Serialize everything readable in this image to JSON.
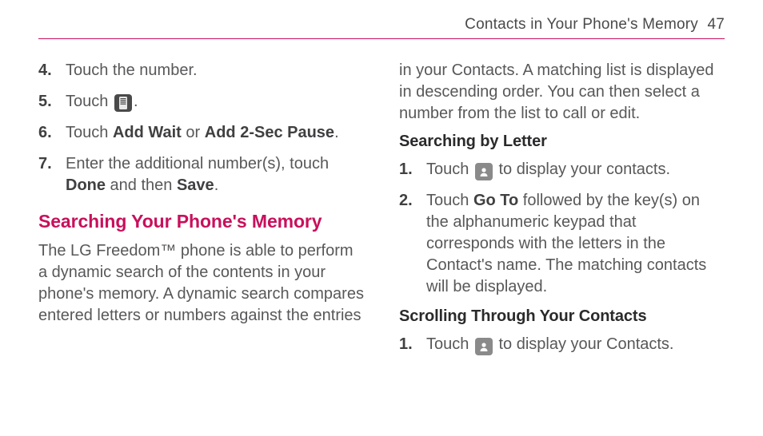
{
  "header": {
    "section": "Contacts in Your Phone's Memory",
    "page_number": "47"
  },
  "left": {
    "steps": [
      {
        "n": "4.",
        "text": "Touch the number."
      },
      {
        "n": "5.",
        "pre": "Touch ",
        "icon": "keypad-icon",
        "post": "."
      },
      {
        "n": "6.",
        "pre": "Touch ",
        "b1": "Add Wait",
        "mid": " or ",
        "b2": "Add 2-Sec Pause",
        "post": "."
      },
      {
        "n": "7.",
        "pre": "Enter the additional number(s), touch ",
        "b1": "Done",
        "mid": " and then ",
        "b2": "Save",
        "post": "."
      }
    ],
    "heading": "Searching Your Phone's Memory",
    "para": "The LG Freedom™ phone is able to perform a dynamic search of the contents in your phone's memory. A dynamic search compares entered letters or numbers against the entries"
  },
  "right": {
    "cont": "in your Contacts. A matching list is displayed in descending order. You can then select a number from the list to call or edit.",
    "sub1": "Searching by Letter",
    "steps1": [
      {
        "n": "1.",
        "pre": "Touch ",
        "icon": "contact-icon",
        "post": " to display your contacts."
      },
      {
        "n": "2.",
        "pre": "Touch ",
        "b1": "Go To",
        "post": " followed by the key(s) on the alphanumeric keypad that corresponds with the letters in the Contact's name. The matching contacts will be displayed."
      }
    ],
    "sub2": "Scrolling Through Your Contacts",
    "steps2": [
      {
        "n": "1.",
        "pre": "Touch ",
        "icon": "contact-icon",
        "post": " to display your Contacts."
      }
    ]
  }
}
